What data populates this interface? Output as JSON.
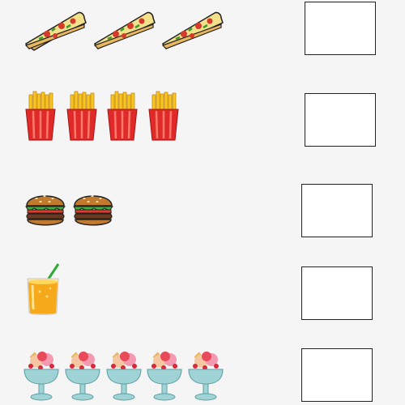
{
  "worksheet": {
    "rows": [
      {
        "food": "pizza-slice",
        "count": 3
      },
      {
        "food": "french-fries",
        "count": 4
      },
      {
        "food": "hamburger",
        "count": 2
      },
      {
        "food": "juice-glass",
        "count": 1
      },
      {
        "food": "ice-cream-sundae",
        "count": 5
      }
    ],
    "colors": {
      "background": "#f5f5f5",
      "box_border": "#222222",
      "fries_red": "#e02a2a",
      "fries_yellow": "#f7c623",
      "pizza_cheese": "#f3e08a",
      "pizza_crust": "#e8b75e",
      "bun": "#c27a2e",
      "juice": "#f6a91a",
      "straw": "#2eaa3a",
      "cup": "#9fd3d6"
    }
  }
}
